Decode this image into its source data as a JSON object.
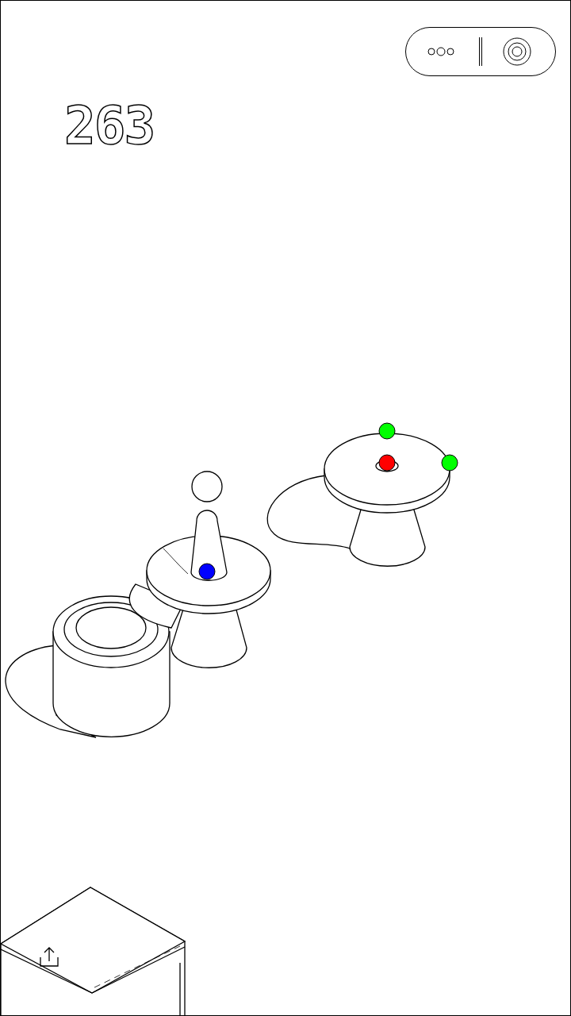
{
  "score": "263",
  "balls": [
    {
      "color": "#0000ff"
    },
    {
      "color": "#ff0000"
    },
    {
      "color": "#00ff00"
    },
    {
      "color": "#00ff00"
    }
  ]
}
